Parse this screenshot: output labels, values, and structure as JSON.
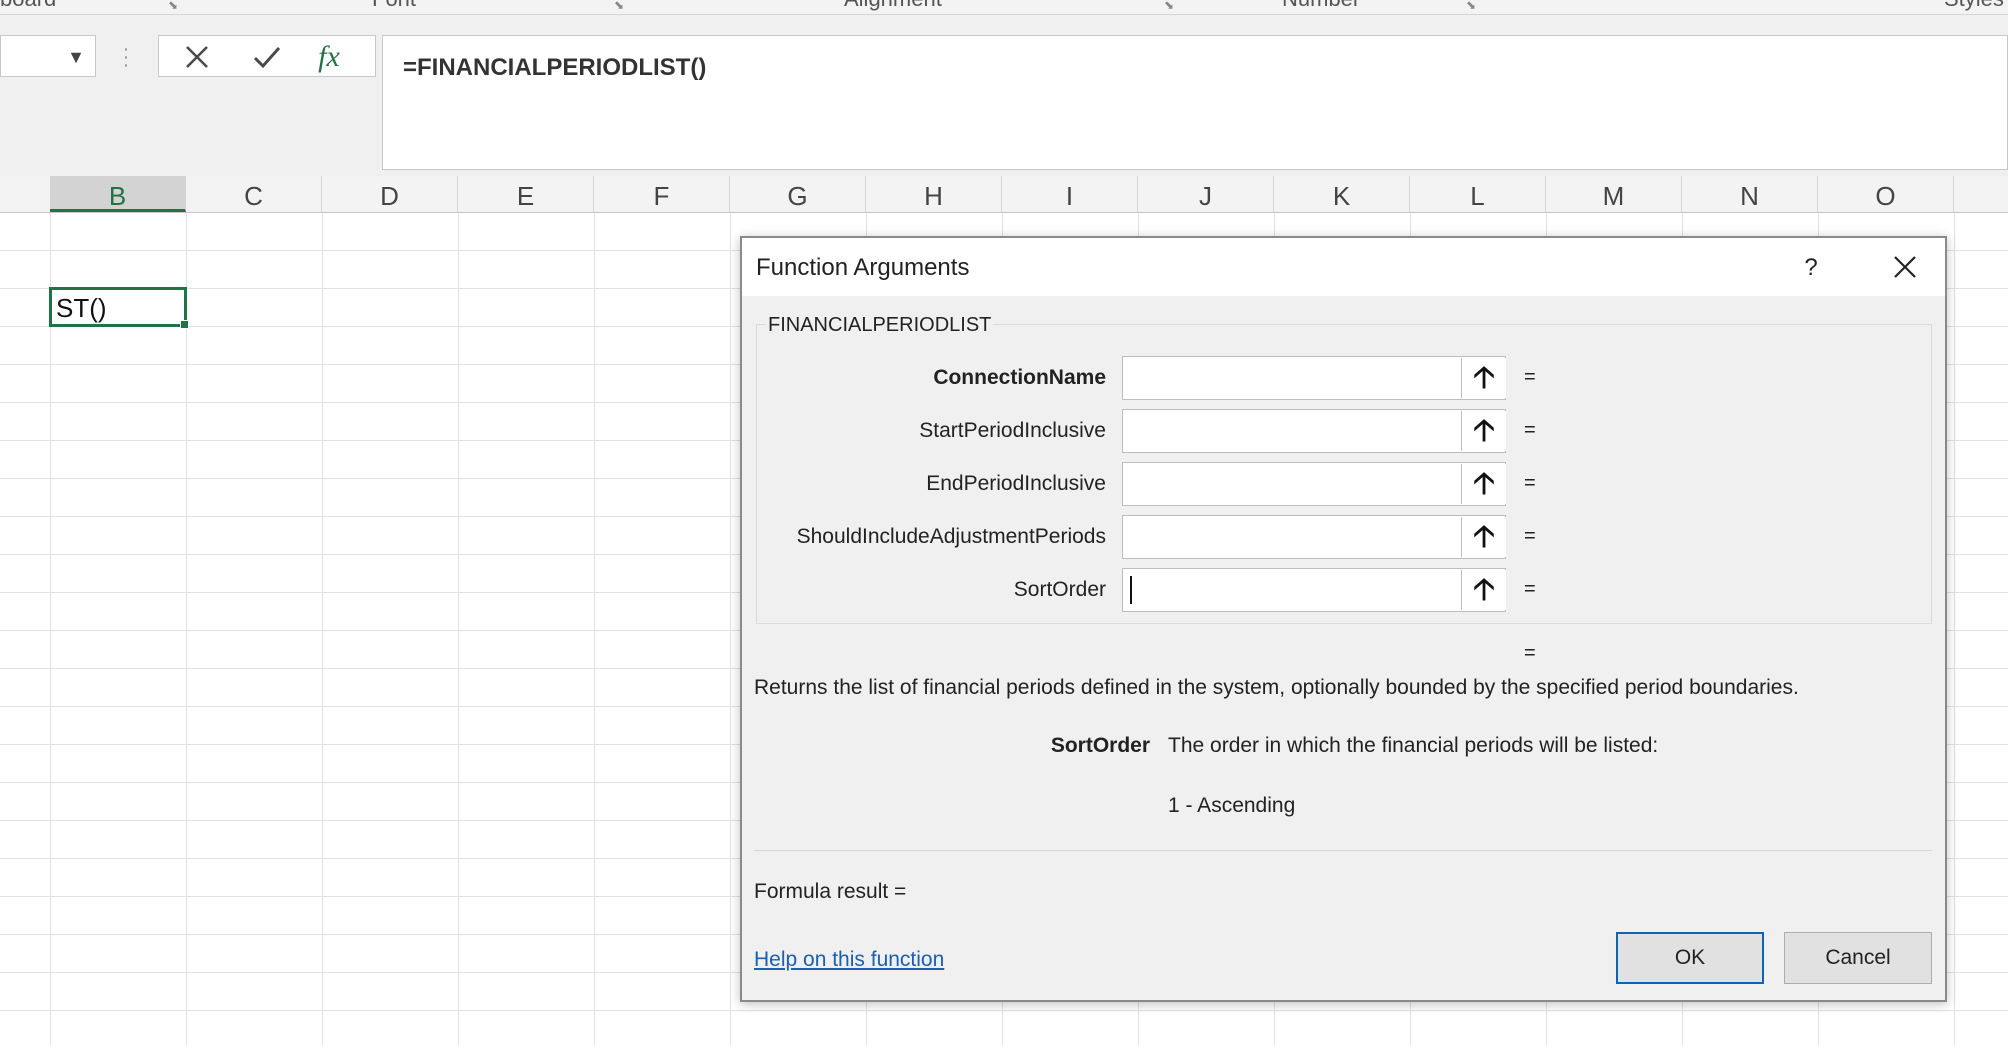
{
  "ribbon": {
    "groups": [
      "board",
      "Font",
      "Alignment",
      "Number",
      "Styles"
    ]
  },
  "formula_bar": {
    "name_box_value": "",
    "cancel_icon": "x-icon",
    "enter_icon": "check-icon",
    "insert_function_label": "fx",
    "formula": "=FINANCIALPERIODLIST()"
  },
  "sheet": {
    "columns": [
      "B",
      "C",
      "D",
      "E",
      "F",
      "G",
      "H",
      "I",
      "J",
      "K",
      "L",
      "M",
      "N",
      "O"
    ],
    "selected_column": "B",
    "active_cell_text": "ST()",
    "accent_color": "#217346"
  },
  "dialog": {
    "title": "Function Arguments",
    "help_label": "?",
    "close_label": "✕",
    "function_name": "FINANCIALPERIODLIST",
    "arguments": [
      {
        "label": "ConnectionName",
        "value": "",
        "equals": "="
      },
      {
        "label": "StartPeriodInclusive",
        "value": "",
        "equals": "="
      },
      {
        "label": "EndPeriodInclusive",
        "value": "",
        "equals": "="
      },
      {
        "label": "ShouldIncludeAdjustmentPeriods",
        "value": "",
        "equals": "="
      },
      {
        "label": "SortOrder",
        "value": "",
        "equals": "="
      }
    ],
    "result_equals": "=",
    "description": "Returns the list of financial periods defined in the system, optionally bounded by the specified period boundaries.",
    "current_arg_name": "SortOrder",
    "current_arg_help": "The order in which the financial periods will be listed:",
    "current_arg_help_line2": "1 - Ascending",
    "formula_result": "Formula result =",
    "help_link": "Help on this function",
    "ok_label": "OK",
    "cancel_label": "Cancel",
    "link_color": "#1a5fb4"
  }
}
